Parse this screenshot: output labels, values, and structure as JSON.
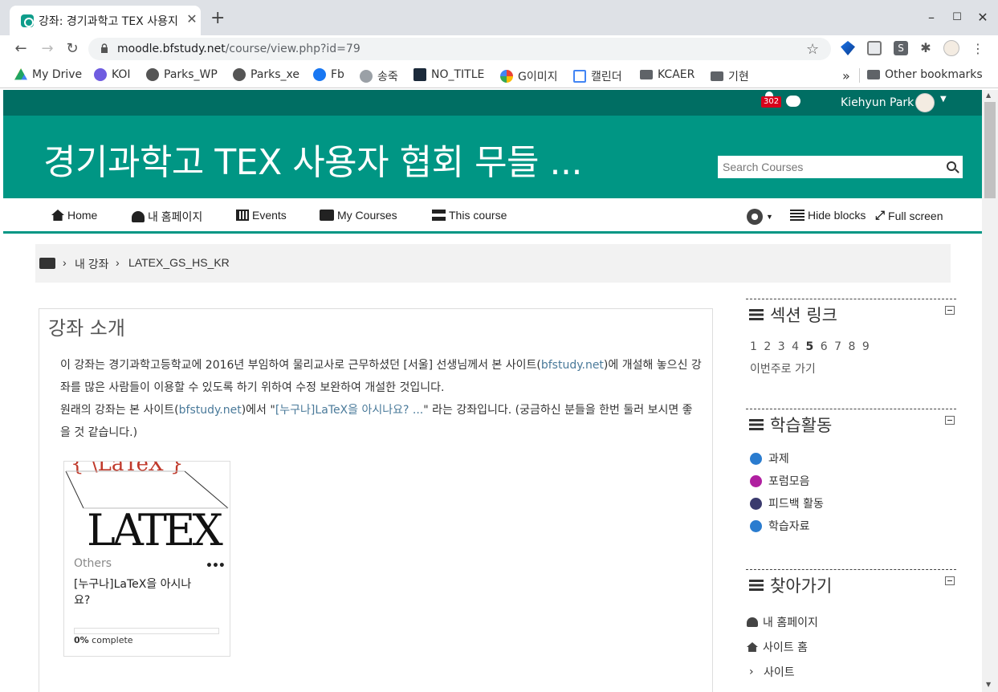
{
  "browser": {
    "tab_title": "강좌: 경기과학고 TEX 사용지",
    "tab_close": "✕",
    "new_tab": "+",
    "url_host": "moodle.bfstudy.net",
    "url_path": "/course/view.php?id=79",
    "window_controls": [
      "–",
      "☐",
      "✕"
    ],
    "bookmarks": [
      {
        "label": "My Drive",
        "icon": "drive-icon",
        "color": "#1fa463"
      },
      {
        "label": "KOI",
        "icon": "koi-icon",
        "color": "#6f5ce0"
      },
      {
        "label": "Parks_WP",
        "icon": "globe-icon",
        "color": "#555555"
      },
      {
        "label": "Parks_xe",
        "icon": "globe-icon",
        "color": "#555555"
      },
      {
        "label": "Fb",
        "icon": "facebook-icon",
        "color": "#1877f2"
      },
      {
        "label": "송죽",
        "icon": "songjuk-icon",
        "color": "#8a8a8a"
      },
      {
        "label": "NO_TITLE",
        "icon": "notitle-icon",
        "color": "#1b2a3a"
      },
      {
        "label": "G이미지",
        "icon": "google-icon",
        "color": "#4285f4"
      },
      {
        "label": "캘린더",
        "icon": "calendar-icon",
        "color": "#fbbc04"
      },
      {
        "label": "KCAER",
        "icon": "folder-icon",
        "color": "#5f6368"
      },
      {
        "label": "기현",
        "icon": "folder-icon",
        "color": "#5f6368"
      }
    ],
    "bookmarks_overflow": "»",
    "other_bookmarks": "Other bookmarks"
  },
  "topbar": {
    "notification_count": "302",
    "username": "Kiehyun Park",
    "caret": "▼"
  },
  "header": {
    "site_title": "경기과학고 TEX 사용자 협회 무들 ...",
    "search_placeholder": "Search Courses"
  },
  "nav": {
    "items": [
      {
        "label": "Home",
        "icon": "home-icon"
      },
      {
        "label": "내 홈페이지",
        "icon": "dashboard-icon"
      },
      {
        "label": "Events",
        "icon": "calendar-icon"
      },
      {
        "label": "My Courses",
        "icon": "briefcase-icon"
      },
      {
        "label": "This course",
        "icon": "sitemap-icon"
      }
    ],
    "hide_blocks": "Hide blocks",
    "full_screen": "Full screen"
  },
  "breadcrumb": {
    "items": [
      "내 강좌",
      "LATEX_GS_HS_KR"
    ],
    "separator": "›"
  },
  "section": {
    "title": "강좌 소개",
    "p1_a": "이 강좌는 경기과학고등학교에 2016년 부임하여 물리교사로 근무하셨던 [서울] 선생님께서 본 사이트(",
    "p1_link": "bfstudy.net",
    "p1_b": ")에 개설해 놓으신 강좌를 많은 사람들이 이용할 수 있도록 하기 위하여 수정 보완하여 개설한 것입니다.",
    "p2_a": "원래의 강좌는 본 사이트(",
    "p2_link1": "bfstudy.net",
    "p2_b": ")에서  \"",
    "p2_link2": "[누구나]LaTeX을 아시나요? ...",
    "p2_c": "\" 라는 강좌입니다. (궁금하신 분들을 한번 둘러 보시면 좋을 것 같습니다.)"
  },
  "card": {
    "image_top_text": "{ \\LaTeX }",
    "image_logo": "LATEX",
    "category": "Others",
    "more": "•••",
    "name": "[누구나]LaTeX을 아시나요?",
    "progress_percent": 0,
    "progress_label_num": "0%",
    "progress_label_text": " complete"
  },
  "blocks": {
    "section_links": {
      "title": "섹션 링크",
      "numbers": [
        "1",
        "2",
        "3",
        "4",
        "5",
        "6",
        "7",
        "8",
        "9"
      ],
      "current": "5",
      "this_week": "이번주로 가기"
    },
    "activities": {
      "title": "학습활동",
      "items": [
        {
          "label": "과제",
          "icon": "assignment-icon",
          "color": "#2a7ccf"
        },
        {
          "label": "포럼모음",
          "icon": "forum-icon",
          "color": "#b01fa0"
        },
        {
          "label": "피드백 활동",
          "icon": "feedback-icon",
          "color": "#3a3a6e"
        },
        {
          "label": "학습자료",
          "icon": "resource-icon",
          "color": "#2a7ccf"
        }
      ]
    },
    "navigation": {
      "title": "찾아가기",
      "items": [
        {
          "label": "내 홈페이지",
          "icon": "dashboard-icon"
        },
        {
          "label": "사이트 홈",
          "icon": "home-icon"
        },
        {
          "label": "사이트",
          "icon": "chevron-right-icon"
        }
      ]
    }
  },
  "colors": {
    "topbar": "#006e63",
    "header": "#009684",
    "accent": "#009684"
  }
}
